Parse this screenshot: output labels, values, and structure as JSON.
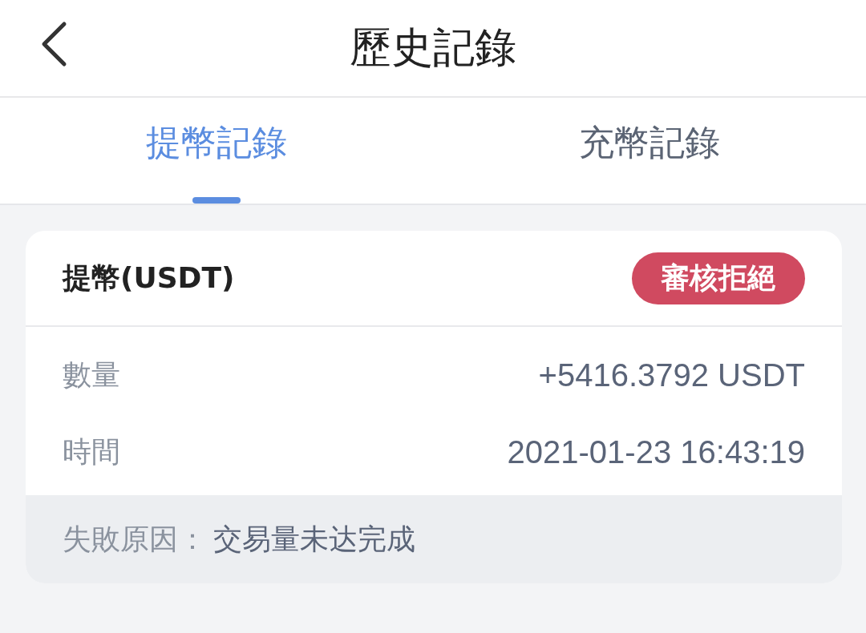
{
  "header": {
    "title": "歷史記錄"
  },
  "tabs": [
    {
      "label": "提幣記錄",
      "selected": true
    },
    {
      "label": "充幣記錄",
      "selected": false
    }
  ],
  "record": {
    "title": "提幣(USDT)",
    "status": "審核拒絕",
    "fields": [
      {
        "label": "數量",
        "value": "+5416.3792 USDT"
      },
      {
        "label": "時間",
        "value": "2021-01-23 16:43:19"
      }
    ],
    "failure": {
      "label": "失敗原因：",
      "value": "交易量未达完成"
    }
  }
}
